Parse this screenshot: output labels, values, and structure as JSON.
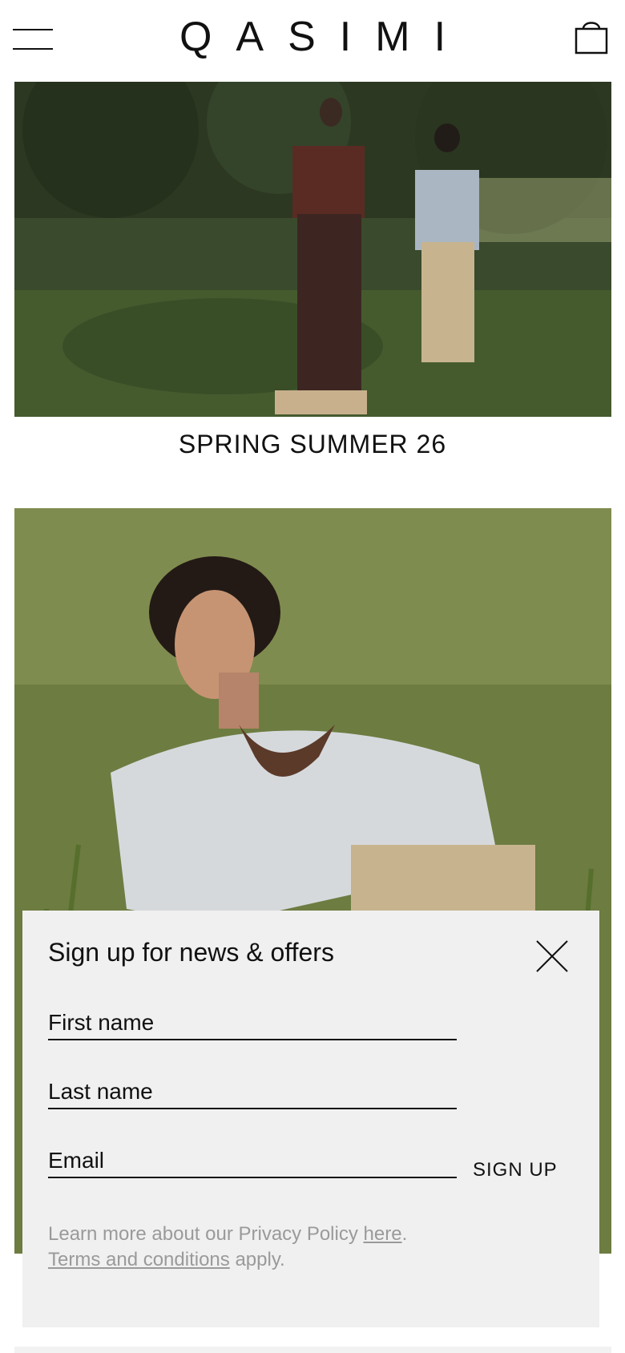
{
  "header": {
    "brand": "QASIMI",
    "menu_icon": "hamburger-menu-icon",
    "bag_icon": "shopping-bag-icon"
  },
  "hero": {
    "image_1": "Two models standing in grass beside a pond",
    "caption": "SPRING SUMMER 26",
    "image_2": "Model in a white knit sweater crouching in tall grass"
  },
  "popup": {
    "title": "Sign up for news & offers",
    "close_icon": "close-icon",
    "first_name_placeholder": "First name",
    "last_name_placeholder": "Last name",
    "email_placeholder": "Email",
    "signup_label": "SIGN UP",
    "privacy_text": "Learn more about our Privacy Policy ",
    "privacy_link": "here",
    "privacy_end": ".",
    "terms_link": "Terms and conditions",
    "terms_end": " apply."
  },
  "colors": {
    "popup_bg": "#f0f0f0",
    "text": "#111111",
    "legal_text": "#9a9a9a"
  }
}
